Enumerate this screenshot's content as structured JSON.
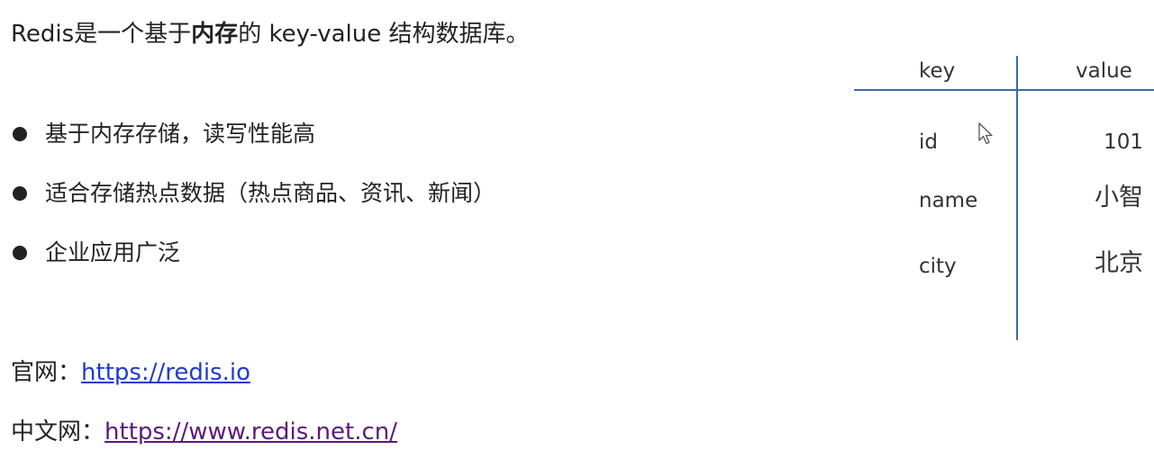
{
  "heading": {
    "prefix": "Redis是一个基于",
    "bold": "内存",
    "suffix": "的 key-value 结构数据库。"
  },
  "bullets": [
    "基于内存存储，读写性能高",
    "适合存储热点数据（热点商品、资讯、新闻）",
    "企业应用广泛"
  ],
  "links": {
    "official": {
      "label": "官网：",
      "url": "https://redis.io"
    },
    "chinese": {
      "label": "中文网：",
      "url": "https://www.redis.net.cn/"
    }
  },
  "table": {
    "headers": {
      "key": "key",
      "value": "value"
    },
    "rows": [
      {
        "key": "id",
        "value": "101"
      },
      {
        "key": "name",
        "value": "小智"
      },
      {
        "key": "city",
        "value": "北京"
      }
    ]
  },
  "colors": {
    "link_official": "#1f3ad1",
    "link_chinese": "#5b1a7a",
    "table_lines": "#3b6ea8"
  },
  "icons": {
    "cursor": "mouse-pointer-icon",
    "bullet": "filled-circle-bullet-icon"
  }
}
